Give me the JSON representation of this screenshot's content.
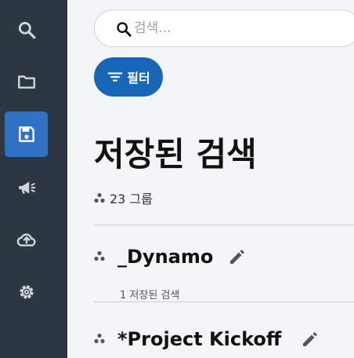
{
  "sidebar": {
    "items": [
      {
        "name": "search",
        "icon": "search-icon"
      },
      {
        "name": "folder",
        "icon": "folder-icon"
      },
      {
        "name": "saved",
        "icon": "save-icon",
        "active": true
      },
      {
        "name": "announcements",
        "icon": "megaphone-icon"
      },
      {
        "name": "upload",
        "icon": "cloud-upload-icon"
      },
      {
        "name": "settings",
        "icon": "gear-icon"
      }
    ]
  },
  "search": {
    "placeholder": "검색...",
    "value": ""
  },
  "filter": {
    "label": "필터"
  },
  "page": {
    "title": "저장된 검색",
    "group_count": "23 그룹"
  },
  "groups": [
    {
      "name": "_Dynamo",
      "subtitle": "1 저장된 검색"
    },
    {
      "name": "*Project Kickoff"
    }
  ],
  "colors": {
    "sidebar_bg": "#2d3741",
    "active_nav": "#2f72c4",
    "filter_button": "#1766b8",
    "background": "#f4f5f7"
  }
}
